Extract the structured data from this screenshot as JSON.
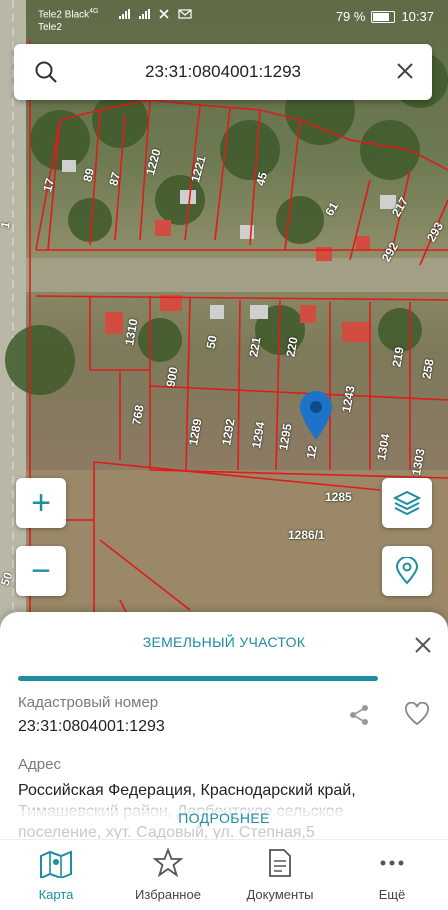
{
  "status": {
    "carrier1": "Tele2 Black",
    "carrier1_sup": "4G",
    "carrier2": "Tele2",
    "battery": "79 %",
    "time": "10:37"
  },
  "search": {
    "query": "23:31:0804001:1293",
    "icon": "search-icon",
    "clear_icon": "close-icon"
  },
  "map": {
    "parcels": [
      "17",
      "89",
      "87",
      "1220",
      "1221",
      "45",
      "61",
      "217",
      "292",
      "293",
      "1310",
      "50",
      "221",
      "220",
      "900",
      "219",
      "258",
      "768",
      "1289",
      "1292",
      "1294",
      "1295",
      "1243",
      "1304",
      "1303",
      "1285",
      "1286/1",
      "12",
      "1",
      "50"
    ],
    "zoom_in": "+",
    "zoom_out": "−"
  },
  "sheet": {
    "title": "ЗЕМЕЛЬНЫЙ УЧАСТОК",
    "cadastral_label": "Кадастровый номер",
    "cadastral_value": "23:31:0804001:1293",
    "address_label": "Адрес",
    "address_line1": "Российская Федерация, Краснодарский край,",
    "address_line2": "Тимашевский район, Дербентское сельское",
    "address_line3": "поселение, хут. Садовый, ул. Степная,5",
    "more_label": "ПОДРОБНЕЕ"
  },
  "nav": [
    {
      "label": "Карта",
      "icon": "map-icon",
      "active": true
    },
    {
      "label": "Избранное",
      "icon": "star-icon",
      "active": false
    },
    {
      "label": "Документы",
      "icon": "document-icon",
      "active": false
    },
    {
      "label": "Ещё",
      "icon": "more-icon",
      "active": false
    }
  ],
  "colors": {
    "accent": "#1e8da0",
    "parcel_border": "#e01b1b"
  }
}
